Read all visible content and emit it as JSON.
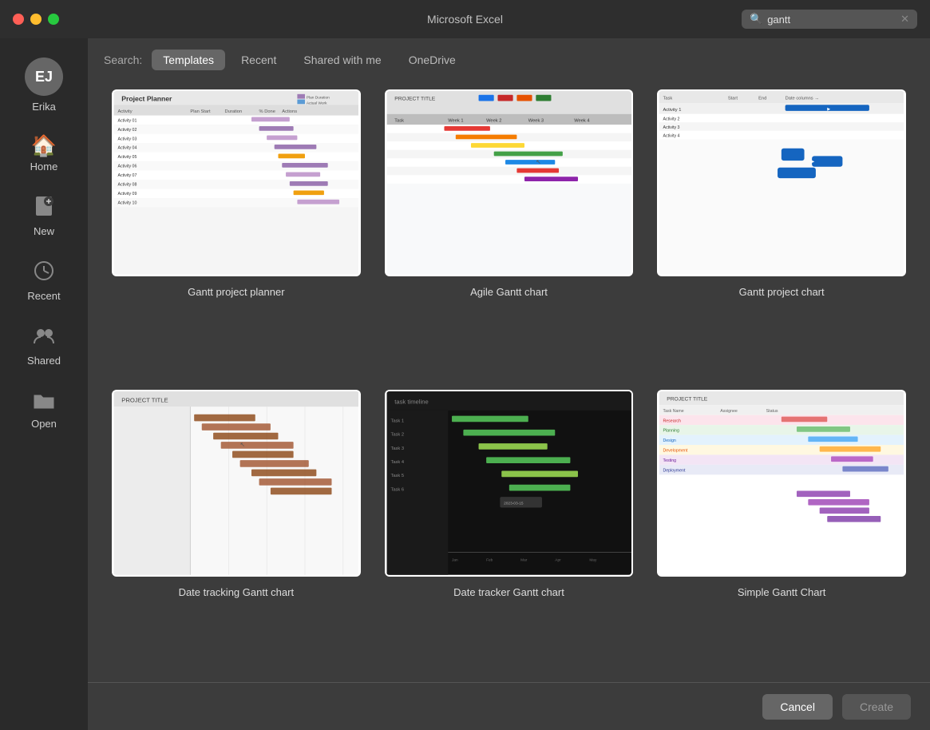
{
  "titlebar": {
    "title": "Microsoft Excel",
    "search_placeholder": "gantt",
    "search_value": "gantt"
  },
  "sidebar": {
    "user_initials": "EJ",
    "user_name": "Erika",
    "items": [
      {
        "id": "home",
        "label": "Home",
        "icon": "🏠"
      },
      {
        "id": "new",
        "label": "New",
        "icon": "📄"
      },
      {
        "id": "recent",
        "label": "Recent",
        "icon": "🕐"
      },
      {
        "id": "shared",
        "label": "Shared",
        "icon": "👥"
      },
      {
        "id": "open",
        "label": "Open",
        "icon": "📁"
      }
    ]
  },
  "search_tabs": {
    "label": "Search:",
    "tabs": [
      {
        "id": "templates",
        "label": "Templates",
        "active": true
      },
      {
        "id": "recent",
        "label": "Recent",
        "active": false
      },
      {
        "id": "shared_with_me",
        "label": "Shared with me",
        "active": false
      },
      {
        "id": "onedrive",
        "label": "OneDrive",
        "active": false
      }
    ]
  },
  "templates": [
    {
      "id": 1,
      "name": "Gantt project planner",
      "type": "gantt_planner"
    },
    {
      "id": 2,
      "name": "Agile Gantt chart",
      "type": "agile_gantt"
    },
    {
      "id": 3,
      "name": "Gantt project chart",
      "type": "gantt_project_chart"
    },
    {
      "id": 4,
      "name": "Date tracking Gantt chart",
      "type": "date_tracking"
    },
    {
      "id": 5,
      "name": "Date tracker Gantt chart",
      "type": "date_tracker_dark"
    },
    {
      "id": 6,
      "name": "Simple Gantt Chart",
      "type": "simple_gantt"
    }
  ],
  "bottom": {
    "cancel_label": "Cancel",
    "create_label": "Create"
  }
}
